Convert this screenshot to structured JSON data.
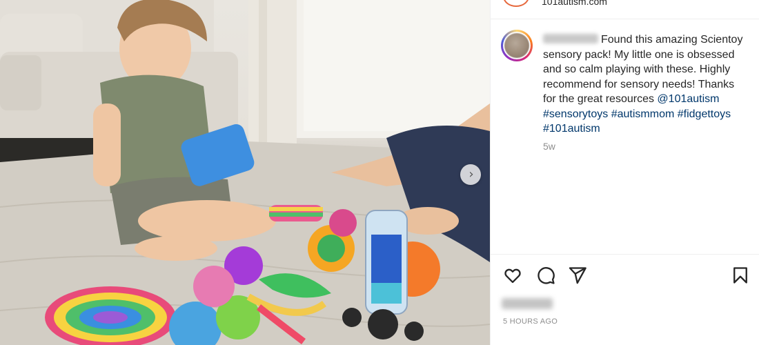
{
  "header": {
    "username_url": "101autism.com"
  },
  "comment": {
    "username": "",
    "text": "Found this amazing Scientoy sensory pack! My little one is obsessed and so calm playing with these. Highly recommend for sensory needs! Thanks for the great resources",
    "mention": "@101autism",
    "hashtags": [
      "#sensorytoys",
      "#autismmom",
      "#fidgettoys",
      "#101autism"
    ],
    "age": "5w"
  },
  "actions": {
    "like_icon": "heart-icon",
    "comment_icon": "comment-icon",
    "share_icon": "share-icon",
    "save_icon": "bookmark-icon"
  },
  "post": {
    "posted_time": "5 HOURS AGO"
  },
  "photo": {
    "next_icon": "chevron-right-icon",
    "next_glyph": "›"
  },
  "colors": {
    "link": "#00376b",
    "text": "#262626",
    "muted": "#8e8e8e",
    "divider": "#efefef"
  }
}
